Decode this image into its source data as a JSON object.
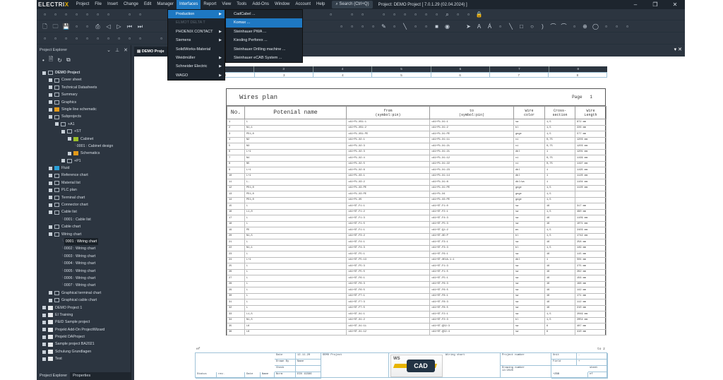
{
  "app": {
    "logo": "ELECTRIX",
    "title": "Project: DEMO Project  [ 7.0.1.29 (02.04.2024) ]",
    "search": "Search (Ctrl+Q)"
  },
  "menu": [
    "Project",
    "File",
    "Insert",
    "Change",
    "Edit",
    "Manager",
    "Interfaces",
    "Report",
    "View",
    "Tools",
    "Add-Ons",
    "Window",
    "Account",
    "Help"
  ],
  "active_menu": "Interfaces",
  "interfaces_menu": [
    {
      "label": "Production",
      "sub": true,
      "highlight": true
    },
    {
      "label": "ELMOT DELTA T",
      "sub": false,
      "disabled": true
    },
    {
      "label": "PHOENIX CONTACT",
      "sub": true
    },
    {
      "label": "Siemens",
      "sub": true
    },
    {
      "label": "SolidWorks-Material",
      "sub": false
    },
    {
      "label": "Weidmüller",
      "sub": true
    },
    {
      "label": "Schneider Electric",
      "sub": true
    },
    {
      "label": "WAGO",
      "sub": true
    }
  ],
  "production_submenu": [
    {
      "label": "CadCabel ..."
    },
    {
      "label": "Komax ...",
      "highlight": true
    },
    {
      "label": "Steinhauer PWA ..."
    },
    {
      "label": "Kiesling Perforex ..."
    },
    {
      "label": "Steinhauer Drilling machine ..."
    },
    {
      "label": "Steinhauer eCAB System ..."
    }
  ],
  "toolbars": [
    [
      "user-icon",
      "bulb-icon",
      "arrow-icon",
      "grid-icon",
      "link-icon",
      "pin-icon",
      "tree-icon",
      "",
      "bulb-icon",
      "board-icon",
      "",
      "",
      "",
      "",
      "",
      "",
      "",
      "",
      "",
      "",
      "",
      "",
      "",
      "",
      "",
      "",
      "",
      "list-icon",
      "",
      "window-icon",
      "plug-icon",
      "",
      "terminal-icon",
      "clamp-icon",
      "bolt-icon",
      "pin-icon",
      "cable-icon",
      "arrow-icon",
      "zoom-icon",
      "table-icon",
      "export-icon",
      "lock-icon"
    ],
    [
      "new-icon",
      "open-icon",
      "save-icon",
      "save-as-icon",
      "save-all-icon",
      "print-icon",
      "prev-icon",
      "next-icon",
      "first-icon",
      "last-icon",
      "",
      "",
      "",
      "",
      "",
      "",
      "",
      "",
      "",
      "",
      "",
      "",
      "",
      "",
      "",
      "",
      "",
      "",
      "wire-icon",
      "pin-icon",
      "pin-icon",
      "box-icon",
      "pencil-icon",
      "line-color-icon",
      "line-icon",
      "fill-icon",
      "fill-color-icon",
      "color-icon",
      "layer-icon",
      "",
      "select-icon",
      "text-icon",
      "text-attr-icon",
      "image-icon",
      "line-icon",
      "rect-icon",
      "circle-icon",
      "arc-icon",
      "arc2-icon",
      "arc3-icon",
      "polyline-icon",
      "crosshair-icon",
      "ellipse-icon",
      "export-icon",
      "import-icon",
      "frame-icon"
    ],
    [
      "grid-icon",
      "table-icon",
      "page-icon",
      "page2-icon",
      "page3-icon",
      "chevron-icon",
      "list-icon",
      "list2-icon",
      "chart-icon",
      "window-icon",
      "",
      "graph-icon"
    ]
  ],
  "sidebar": {
    "title": "Project Explorer",
    "tabs": [
      "Project Explorer",
      "Properties"
    ],
    "tree": [
      {
        "d": 0,
        "t": "DEMO Project",
        "bold": true
      },
      {
        "d": 1,
        "t": "Cover sheet"
      },
      {
        "d": 1,
        "t": "Technical Datasheets"
      },
      {
        "d": 1,
        "t": "Summary"
      },
      {
        "d": 1,
        "t": "Graphics"
      },
      {
        "d": 1,
        "t": "Single line schematic",
        "c": "#e39a1a"
      },
      {
        "d": 1,
        "t": "Subprojects"
      },
      {
        "d": 2,
        "t": "+A1"
      },
      {
        "d": 3,
        "t": "+ST"
      },
      {
        "d": 4,
        "t": "Cabinet",
        "c": "#9bbf2a"
      },
      {
        "d": 5,
        "t": "0001 : Cabinet design",
        "leaf": true
      },
      {
        "d": 4,
        "t": "Schematics",
        "c": "#e39a1a"
      },
      {
        "d": 3,
        "t": "+P1"
      },
      {
        "d": 1,
        "t": "Fluid",
        "c": "#2aa0d8"
      },
      {
        "d": 1,
        "t": "Reference chart"
      },
      {
        "d": 1,
        "t": "Material list"
      },
      {
        "d": 1,
        "t": "PLC plan"
      },
      {
        "d": 1,
        "t": "Terminal chart"
      },
      {
        "d": 1,
        "t": "Connector chart"
      },
      {
        "d": 1,
        "t": "Cable list"
      },
      {
        "d": 3,
        "t": "0001 : Cable list",
        "leaf": true
      },
      {
        "d": 1,
        "t": "Cable chart"
      },
      {
        "d": 1,
        "t": "Wiring chart"
      },
      {
        "d": 3,
        "t": "0001 : Wiring chart",
        "leaf": true,
        "sel": true
      },
      {
        "d": 3,
        "t": "0002 : Wiring chart",
        "leaf": true
      },
      {
        "d": 3,
        "t": "0003 : Wiring chart",
        "leaf": true
      },
      {
        "d": 3,
        "t": "0004 : Wiring chart",
        "leaf": true
      },
      {
        "d": 3,
        "t": "0005 : Wiring chart",
        "leaf": true
      },
      {
        "d": 3,
        "t": "0006 : Wiring chart",
        "leaf": true
      },
      {
        "d": 3,
        "t": "0007 : Wiring chart",
        "leaf": true
      },
      {
        "d": 1,
        "t": "Graphical terminal chart"
      },
      {
        "d": 1,
        "t": "Graphical cable chart"
      },
      {
        "d": 0,
        "t": "DEMO Project 1",
        "f": true
      },
      {
        "d": 0,
        "t": "EI Training",
        "f": true
      },
      {
        "d": 0,
        "t": "P&ID Sample project",
        "f": true
      },
      {
        "d": 0,
        "t": "Projekt Add-On ProjectWizard",
        "f": true
      },
      {
        "d": 0,
        "t": "Projekt DAProject",
        "f": true
      },
      {
        "d": 0,
        "t": "Sample project BA2021",
        "f": true
      },
      {
        "d": 0,
        "t": "Schulung Grundlagen",
        "f": true
      },
      {
        "d": 0,
        "t": "Test",
        "f": true
      }
    ]
  },
  "document": {
    "tab": "DEMO Proje",
    "ruler": [
      "2",
      "3",
      "4",
      "5",
      "6",
      "7",
      "8"
    ],
    "colnums": [
      "2",
      "3",
      "4",
      "5",
      "6",
      "7",
      "8"
    ]
  },
  "wires_plan": {
    "title": "Wires plan",
    "page_label": "Page",
    "page": "1",
    "headers": [
      "No.",
      "Potenial name",
      "from\n(symbol:pin)",
      "to\n(symbol:pin)",
      "Wire\ncolor",
      "Cross-\nsection",
      "Wire\nLength"
    ],
    "rows": [
      [
        "1",
        "L",
        "=A1+P1-XS1:1",
        "=A1+P1-X1:1",
        "sw",
        "1,5",
        "872 mm"
      ],
      [
        "2",
        "N1,1",
        "=A1+P1-XS1:2",
        "=A1+P1-X1:2",
        "bl",
        "1,5",
        "226 mm"
      ],
      [
        "3",
        "PE1,0",
        "=A1+P1-XS1:PE",
        "=A1+P1-X1:PE",
        "gnge",
        "1,5",
        "577 mm"
      ],
      [
        "4",
        "N2",
        "=A1+P1-X2:1",
        "=A1+P1-X1:11",
        "vi",
        "0,75",
        "1203 mm"
      ],
      [
        "5",
        "N3",
        "=A1+P1-X2:3",
        "=A1+P1-X1:21",
        "vi",
        "0,75",
        "1203 mm"
      ],
      [
        "6",
        "L+1",
        "=A1+P1-X2:3",
        "=A1+P1-X1:21",
        "dbl",
        "1",
        "1201 mm"
      ],
      [
        "7",
        "N4",
        "=A1+P1-X2:4",
        "=A1+P1-X1:12",
        "vi",
        "0,75",
        "1199 mm"
      ],
      [
        "8",
        "N5",
        "=A1+P1-X2:5",
        "=A1+P1-X1:22",
        "vi",
        "0,75",
        "1197 mm"
      ],
      [
        "9",
        "L+1",
        "=A1+P1-X2:6",
        "=A1+P1-X1:23",
        "dbl",
        "1",
        "1195 mm"
      ],
      [
        "10",
        "L+1",
        "=A1+P1-X3:1",
        "=A1+P1-X1:14",
        "dbl",
        "1",
        "1120 mm"
      ],
      [
        "11",
        "L-",
        "=A1+P1-X3:2",
        "=A1+P1-X1:N",
        "dbl/ws",
        "1",
        "1104 mm"
      ],
      [
        "12",
        "PE1,0",
        "=A1+P1-X3:PE",
        "=A1+P1-X1:PE",
        "gnge",
        "1,5",
        "1120 mm"
      ],
      [
        "13",
        "PE1,0",
        "=A1+P1-X3:PE",
        "=A1+P1-X4",
        "gnge",
        "1,5",
        ""
      ],
      [
        "14",
        "PE1,0",
        "=A1+P1-X5",
        "=A1+P1-X3:PE",
        "gnge",
        "1,5",
        ""
      ],
      [
        "15",
        "L",
        "=A1+ST-F1:1",
        "=A1+ST-F1:0",
        "sw",
        "16",
        "317 mm"
      ],
      [
        "16",
        "L1,0",
        "=A1+ST-F1:2",
        "=A1+ST-F2:1",
        "sw",
        "1,5",
        "490 mm"
      ],
      [
        "17",
        "L",
        "=A1+ST-F1:3",
        "=A1+ST-F4:3",
        "sw",
        "16",
        "1109 mm"
      ],
      [
        "18",
        "L",
        "=A1+ST-F1:5",
        "=A1+ST-F5:3",
        "sw",
        "16",
        "1071 mm"
      ],
      [
        "19",
        "PE",
        "=A1+ST-F1:1",
        "=A1+ST-Q1:2",
        "ws",
        "1,5",
        "2403 mm"
      ],
      [
        "20",
        "N1,5",
        "=A1+ST-F3:2",
        "=A1+ST-XD:P",
        "bl",
        "1,5",
        "1742 mm"
      ],
      [
        "21",
        "L",
        "=A1+ST-F4:1",
        "=A1+ST-F3:1",
        "sw",
        "16",
        "258 mm"
      ],
      [
        "22",
        "N1,1",
        "=A1+ST-F4:3",
        "=A1+ST-F3:3",
        "bl",
        "1,5",
        "149 mm"
      ],
      [
        "23",
        "L",
        "=A1+ST-F5:1",
        "=A1+ST-F6:1",
        "sw",
        "16",
        "115 mm"
      ],
      [
        "24",
        "L+1",
        "=A1+ST-F5:13",
        "=A1+ST-XE1A.1:1",
        "dbl",
        "1",
        "504 mm"
      ],
      [
        "25",
        "L",
        "=A1+ST-F5:3",
        "=A1+ST-F1:3",
        "sw",
        "16",
        "275 mm"
      ],
      [
        "26",
        "L",
        "=A1+ST-F5:5",
        "=A1+ST-F1:5",
        "sw",
        "16",
        "262 mm"
      ],
      [
        "27",
        "L",
        "=A1+ST-F6:1",
        "=A1+ST-F5:1",
        "sw",
        "16",
        "156 mm"
      ],
      [
        "28",
        "L",
        "=A1+ST-F6:3",
        "=A1+ST-F6:3",
        "sw",
        "16",
        "168 mm"
      ],
      [
        "29",
        "L",
        "=A1+ST-F6:5",
        "=A1+ST-F6:5",
        "sw",
        "16",
        "142 mm"
      ],
      [
        "30",
        "L",
        "=A1+ST-F7:1",
        "=A1+ST-F8:1",
        "sw",
        "16",
        "171 mm"
      ],
      [
        "31",
        "L",
        "=A1+ST-F7:3",
        "=A1+ST-F8:3",
        "sw",
        "16",
        "112 mm"
      ],
      [
        "32",
        "L",
        "=A1+ST-F7:5",
        "=A1+ST-F8:5",
        "sw",
        "16",
        "210 mm"
      ],
      [
        "33",
        "L1,5",
        "=A1+ST-X1:1",
        "=A1+ST-F2:1",
        "sw",
        "1,5",
        "2049 mm"
      ],
      [
        "34",
        "N1,5",
        "=A1+ST-X1:2",
        "=A1+ST-F2:3",
        "bl",
        "1,5",
        "2054 mm"
      ],
      [
        "35",
        "L6",
        "=A1+ST-X1:11",
        "=A1+ST-Q52:3",
        "sw",
        "6",
        "407 mm"
      ],
      [
        "36",
        "L6",
        "=A1+ST-X1:12",
        "=A1+ST-Q52:4",
        "sw",
        "6",
        "410 mm"
      ]
    ]
  },
  "footer": {
    "left": "ef",
    "right": "to 2"
  },
  "title_block": {
    "date_label": "Date",
    "date": "12.11.20",
    "drawn_label": "Drawn By",
    "drawn": "Name",
    "check_label": "Check",
    "norm_label": "Norm",
    "norm": "DIN 19386",
    "status": "Status",
    "rev": "rev.",
    "date2": "Date",
    "name": "Name",
    "project": "DEMO Project",
    "logo": "WSCAD",
    "chart": "Wiring chart",
    "project_number": "Project number",
    "drawing_number_label": "Drawing number",
    "drawing_number": "12/2020",
    "unit_label": "Unit",
    "unit": "-",
    "field_label": "Field",
    "field": "+",
    "plant": "+ZBB",
    "sheet_label": "sheet",
    "sheet": "ef"
  },
  "colors": {
    "accent": "#1e78c2",
    "app_bg": "#2c3540",
    "menubar": "#1d252e"
  }
}
